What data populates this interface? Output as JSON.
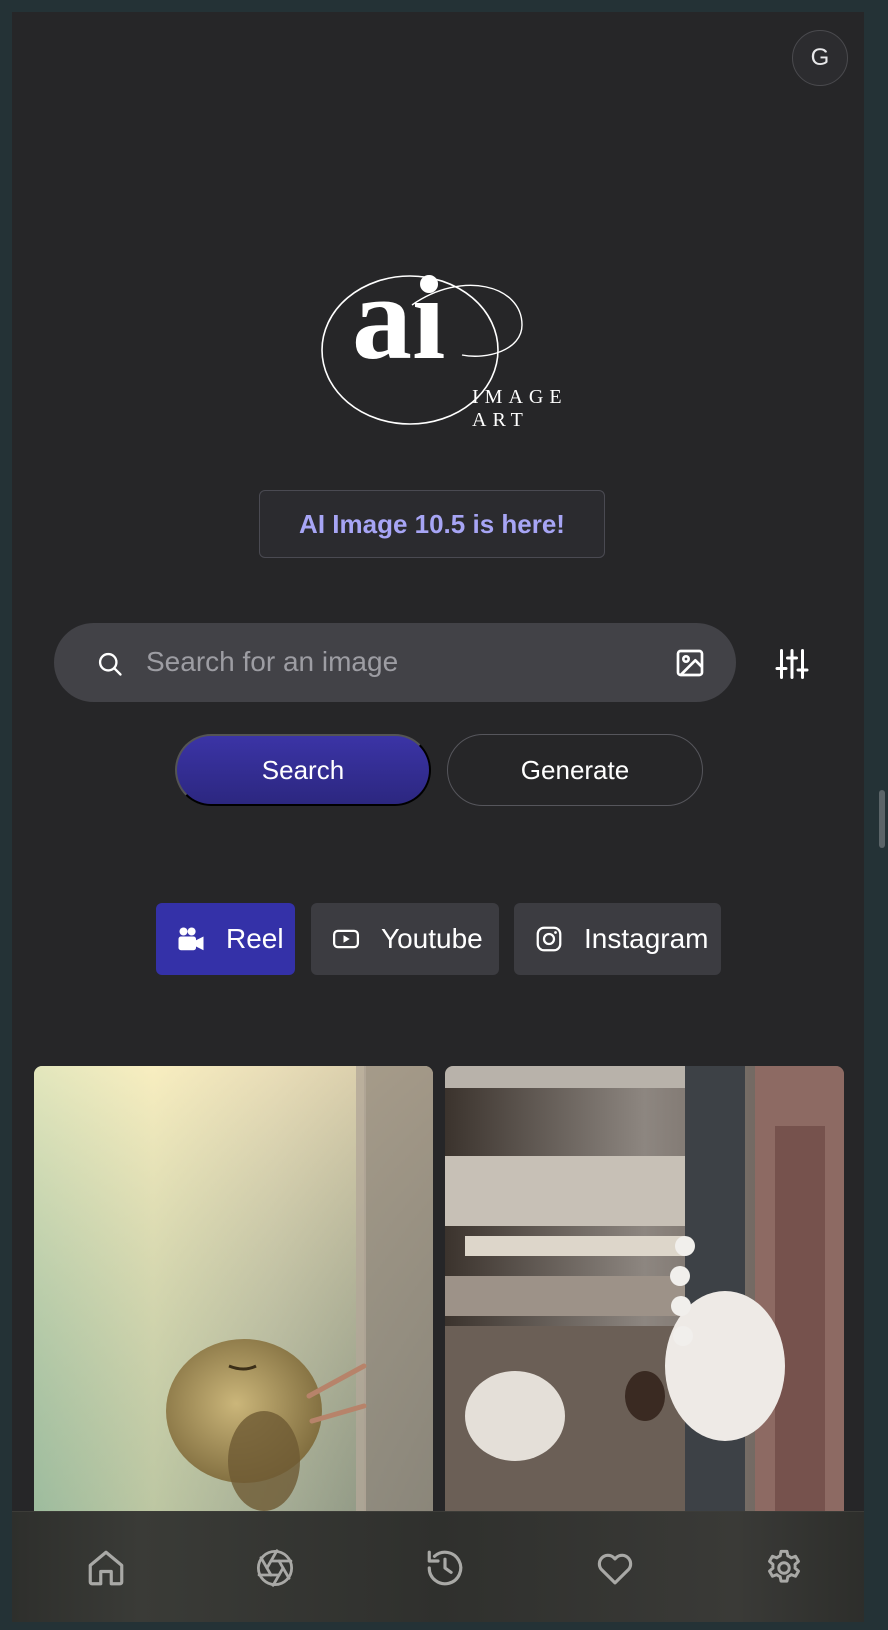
{
  "header": {
    "avatar_initial": "G"
  },
  "logo": {
    "mark": "ai",
    "line1": "IMAGE",
    "line2": "ART"
  },
  "announcement": {
    "text": "AI Image 10.5 is here!"
  },
  "search": {
    "placeholder": "Search for an image",
    "value": "",
    "search_icon": "search-icon",
    "upload_icon": "image-upload-icon",
    "filters_icon": "sliders-icon"
  },
  "actions": {
    "search_label": "Search",
    "generate_label": "Generate"
  },
  "formats": [
    {
      "label": "Reel",
      "icon": "video-camera-icon",
      "selected": true
    },
    {
      "label": "Youtube",
      "icon": "youtube-icon",
      "selected": false
    },
    {
      "label": "Instagram",
      "icon": "instagram-icon",
      "selected": false
    }
  ],
  "gallery": [
    {
      "subject": "bird-on-wall-image"
    },
    {
      "subject": "mosque-prayer-image"
    }
  ],
  "bottom_nav": [
    {
      "icon": "home-icon"
    },
    {
      "icon": "aperture-icon"
    },
    {
      "icon": "history-icon"
    },
    {
      "icon": "heart-icon"
    },
    {
      "icon": "settings-icon"
    }
  ],
  "colors": {
    "background": "#262628",
    "accent": "#3431a8",
    "announcement_text": "#a7a5f5",
    "chip": "#3c3c41"
  }
}
